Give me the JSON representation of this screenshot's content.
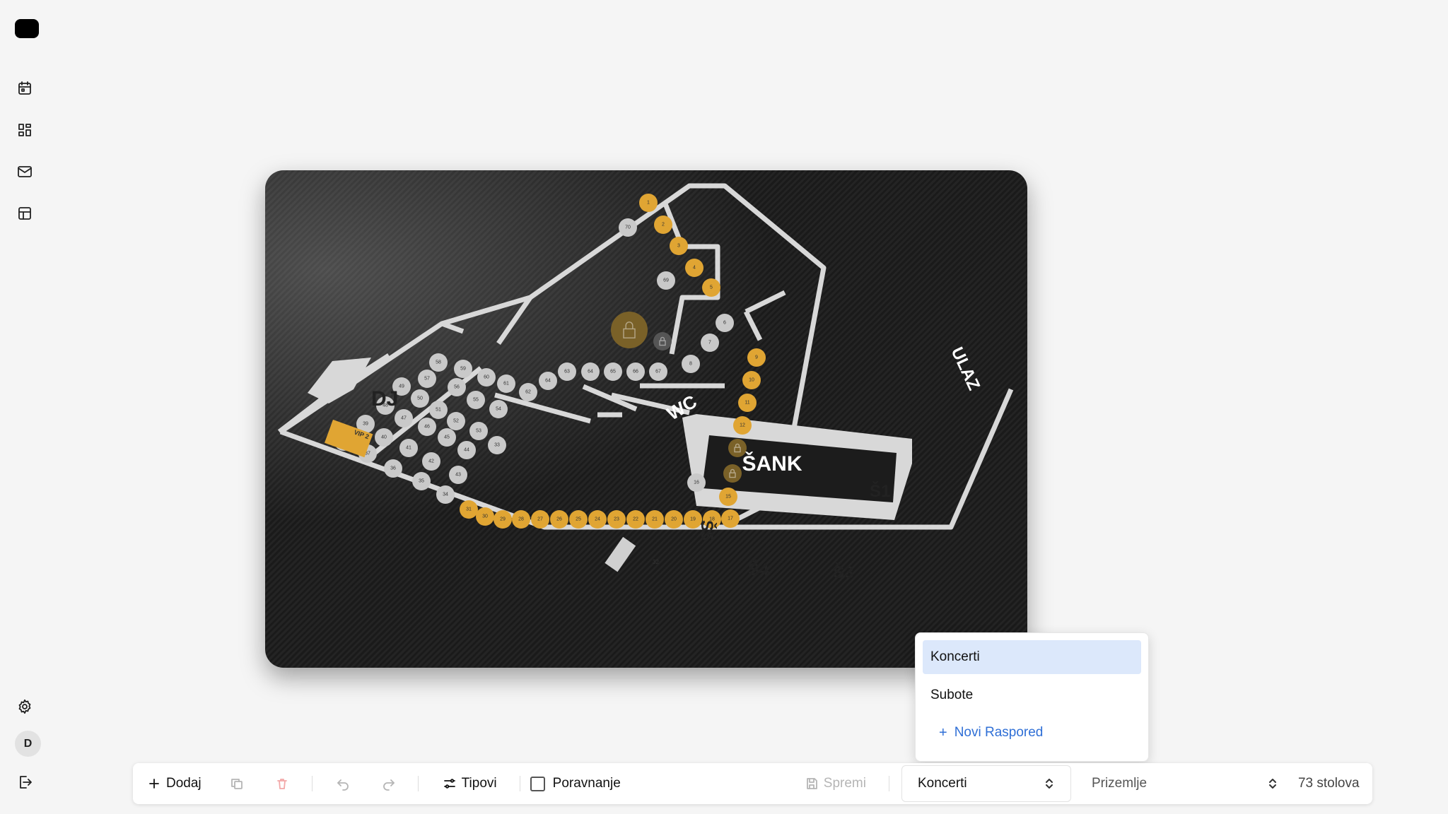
{
  "sidebar": {
    "items": [
      {
        "name": "calendar-icon"
      },
      {
        "name": "dashboard-icon"
      },
      {
        "name": "mail-icon"
      },
      {
        "name": "table-layout-icon"
      }
    ],
    "bottom": [
      {
        "name": "gear-icon"
      },
      {
        "name": "logout-icon"
      }
    ],
    "avatar_initial": "D"
  },
  "floorplan": {
    "labels": {
      "dj": "DJ",
      "vip": "VIP 2",
      "wc": "WC",
      "ulaz": "ULAZ",
      "sank": "ŠANK",
      "s1": "Š1",
      "s3": "Š3",
      "s4": "Š4",
      "s5": "Š5",
      "t32": "32"
    },
    "tables": [
      {
        "n": "1",
        "status": "reserved"
      },
      {
        "n": "2",
        "status": "reserved"
      },
      {
        "n": "3",
        "status": "reserved"
      },
      {
        "n": "4",
        "status": "reserved"
      },
      {
        "n": "5",
        "status": "reserved"
      },
      {
        "n": "6",
        "status": "free"
      },
      {
        "n": "7",
        "status": "free"
      },
      {
        "n": "8",
        "status": "free"
      },
      {
        "n": "9",
        "status": "reserved"
      },
      {
        "n": "10",
        "status": "reserved"
      },
      {
        "n": "11",
        "status": "reserved"
      },
      {
        "n": "12",
        "status": "reserved"
      },
      {
        "n": "",
        "status": "locked"
      },
      {
        "n": "",
        "status": "locked"
      },
      {
        "n": "15",
        "status": "reserved"
      },
      {
        "n": "16",
        "status": "free"
      },
      {
        "n": "17",
        "status": "reserved"
      },
      {
        "n": "18",
        "status": "reserved"
      },
      {
        "n": "19",
        "status": "reserved"
      },
      {
        "n": "20",
        "status": "reserved"
      },
      {
        "n": "21",
        "status": "reserved"
      },
      {
        "n": "22",
        "status": "reserved"
      },
      {
        "n": "23",
        "status": "reserved"
      },
      {
        "n": "24",
        "status": "reserved"
      },
      {
        "n": "25",
        "status": "reserved"
      },
      {
        "n": "26",
        "status": "reserved"
      },
      {
        "n": "27",
        "status": "reserved"
      },
      {
        "n": "28",
        "status": "reserved"
      },
      {
        "n": "29",
        "status": "reserved"
      },
      {
        "n": "30",
        "status": "reserved"
      },
      {
        "n": "31",
        "status": "reserved"
      },
      {
        "n": "33",
        "status": "free"
      },
      {
        "n": "34",
        "status": "free"
      },
      {
        "n": "35",
        "status": "free"
      },
      {
        "n": "36",
        "status": "free"
      },
      {
        "n": "37",
        "status": "free"
      },
      {
        "n": "38",
        "status": "free"
      },
      {
        "n": "39",
        "status": "free"
      },
      {
        "n": "40",
        "status": "free"
      },
      {
        "n": "41",
        "status": "free"
      },
      {
        "n": "42",
        "status": "free"
      },
      {
        "n": "43",
        "status": "free"
      },
      {
        "n": "44",
        "status": "free"
      },
      {
        "n": "45",
        "status": "free"
      },
      {
        "n": "46",
        "status": "free"
      },
      {
        "n": "47",
        "status": "free"
      },
      {
        "n": "48",
        "status": "free"
      },
      {
        "n": "49",
        "status": "free"
      },
      {
        "n": "50",
        "status": "free"
      },
      {
        "n": "51",
        "status": "free"
      },
      {
        "n": "52",
        "status": "free"
      },
      {
        "n": "53",
        "status": "free"
      },
      {
        "n": "54",
        "status": "free"
      },
      {
        "n": "55",
        "status": "free"
      },
      {
        "n": "56",
        "status": "free"
      },
      {
        "n": "57",
        "status": "free"
      },
      {
        "n": "58",
        "status": "free"
      },
      {
        "n": "59",
        "status": "free"
      },
      {
        "n": "60",
        "status": "free"
      },
      {
        "n": "61",
        "status": "free"
      },
      {
        "n": "62",
        "status": "free"
      },
      {
        "n": "63",
        "status": "free"
      },
      {
        "n": "64",
        "status": "free"
      },
      {
        "n": "64",
        "status": "free"
      },
      {
        "n": "65",
        "status": "free"
      },
      {
        "n": "66",
        "status": "free"
      },
      {
        "n": "67",
        "status": "free"
      },
      {
        "n": "69",
        "status": "free"
      },
      {
        "n": "70",
        "status": "free"
      },
      {
        "n": "",
        "status": "locked-big"
      },
      {
        "n": "",
        "status": "locked-grey"
      }
    ]
  },
  "dropdown": {
    "options": [
      "Koncerti",
      "Subote"
    ],
    "selected": "Koncerti",
    "add_label": "Novi Raspored"
  },
  "toolbar": {
    "add_label": "Dodaj",
    "types_label": "Tipovi",
    "align_label": "Poravnanje",
    "save_label": "Spremi",
    "layout_select": "Koncerti",
    "floor_select": "Prizemlje",
    "table_count": "73 stolova"
  },
  "colors": {
    "reserved": "#e0a533",
    "free": "#c9c9c9",
    "locked": "#7a6128",
    "accent": "#2f6fd6"
  }
}
